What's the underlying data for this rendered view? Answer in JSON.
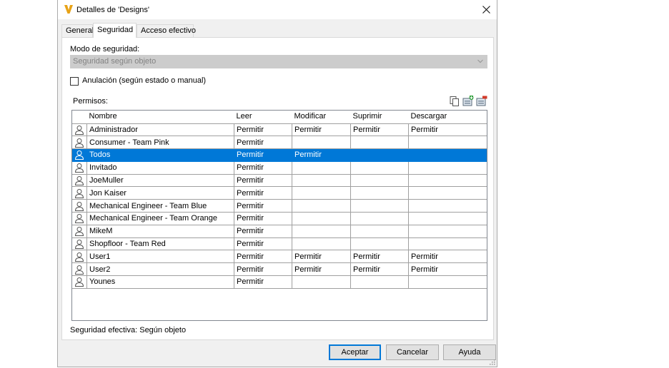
{
  "window": {
    "title": "Detalles de 'Designs'"
  },
  "tabs": [
    {
      "label": "General",
      "active": false
    },
    {
      "label": "Seguridad",
      "active": true
    },
    {
      "label": "Acceso efectivo",
      "active": false
    }
  ],
  "security": {
    "mode_label": "Modo de seguridad:",
    "mode_value": "Seguridad según objeto",
    "override_label": "Anulación (según estado o manual)",
    "override_checked": false,
    "permissions_label": "Permisos:",
    "effective": "Seguridad efectiva: Según objeto"
  },
  "table": {
    "headers": [
      "Nombre",
      "Leer",
      "Modificar",
      "Suprimir",
      "Descargar"
    ],
    "rows": [
      {
        "name": "Administrador",
        "read": "Permitir",
        "modify": "Permitir",
        "delete": "Permitir",
        "download": "Permitir",
        "selected": false
      },
      {
        "name": "Consumer - Team Pink",
        "read": "Permitir",
        "modify": "",
        "delete": "",
        "download": "",
        "selected": false
      },
      {
        "name": "Todos",
        "read": "Permitir",
        "modify": "Permitir",
        "delete": "",
        "download": "",
        "selected": true
      },
      {
        "name": "Invitado",
        "read": "Permitir",
        "modify": "",
        "delete": "",
        "download": "",
        "selected": false
      },
      {
        "name": "JoeMuller",
        "read": "Permitir",
        "modify": "",
        "delete": "",
        "download": "",
        "selected": false
      },
      {
        "name": "Jon Kaiser",
        "read": "Permitir",
        "modify": "",
        "delete": "",
        "download": "",
        "selected": false
      },
      {
        "name": "Mechanical Engineer - Team Blue",
        "read": "Permitir",
        "modify": "",
        "delete": "",
        "download": "",
        "selected": false
      },
      {
        "name": "Mechanical Engineer - Team Orange",
        "read": "Permitir",
        "modify": "",
        "delete": "",
        "download": "",
        "selected": false
      },
      {
        "name": "MikeM",
        "read": "Permitir",
        "modify": "",
        "delete": "",
        "download": "",
        "selected": false
      },
      {
        "name": "Shopfloor - Team Red",
        "read": "Permitir",
        "modify": "",
        "delete": "",
        "download": "",
        "selected": false
      },
      {
        "name": "User1",
        "read": "Permitir",
        "modify": "Permitir",
        "delete": "Permitir",
        "download": "Permitir",
        "selected": false
      },
      {
        "name": "User2",
        "read": "Permitir",
        "modify": "Permitir",
        "delete": "Permitir",
        "download": "Permitir",
        "selected": false
      },
      {
        "name": "Younes",
        "read": "Permitir",
        "modify": "",
        "delete": "",
        "download": "",
        "selected": false
      }
    ]
  },
  "buttons": {
    "ok": "Aceptar",
    "cancel": "Cancelar",
    "help": "Ayuda"
  },
  "icons": {
    "app": "vault-logo-icon",
    "close": "close-icon",
    "copy": "copy-icon",
    "add": "add-user-icon",
    "remove": "remove-user-icon",
    "user": "user-icon"
  },
  "colors": {
    "selection": "#0078d7",
    "logo": "#e8a317"
  }
}
